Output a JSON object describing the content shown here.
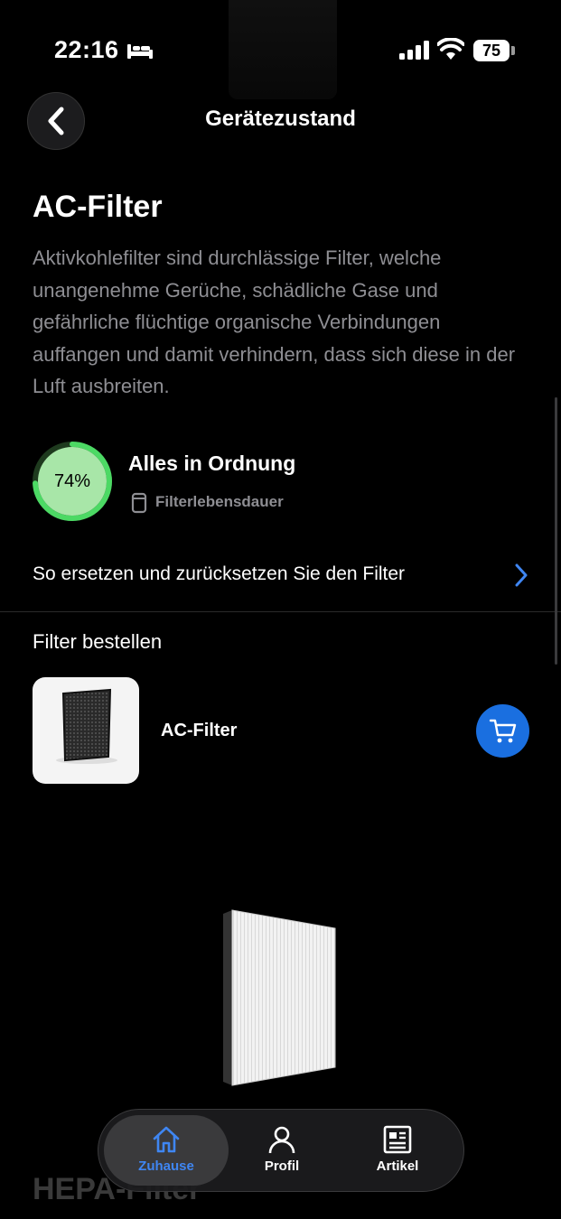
{
  "status_bar": {
    "time": "22:16",
    "battery": "75"
  },
  "header": {
    "title": "Gerätezustand"
  },
  "filter": {
    "title": "AC-Filter",
    "description": "Aktivkohlefilter sind durchlässige Filter, welche unangenehme Gerüche, schädliche Gase und gefährliche flüchtige organische Verbindungen auffangen und damit verhindern, dass sich diese in der Luft ausbreiten.",
    "life_percent": "74%",
    "life_fraction": 0.74,
    "status": "Alles in Ordnung",
    "status_sub": "Filterlebensdauer",
    "accent_color": "#4cd964"
  },
  "replace_link": {
    "label": "So ersetzen und zurücksetzen Sie den Filter"
  },
  "order": {
    "title": "Filter bestellen",
    "product_name": "AC-Filter",
    "cart_color": "#1a6fe0"
  },
  "next_section": {
    "title": "HEPA-Filter"
  },
  "tabs": [
    {
      "label": "Zuhause",
      "icon": "home-icon",
      "active": true
    },
    {
      "label": "Profil",
      "icon": "person-icon",
      "active": false
    },
    {
      "label": "Artikel",
      "icon": "article-icon",
      "active": false
    }
  ]
}
